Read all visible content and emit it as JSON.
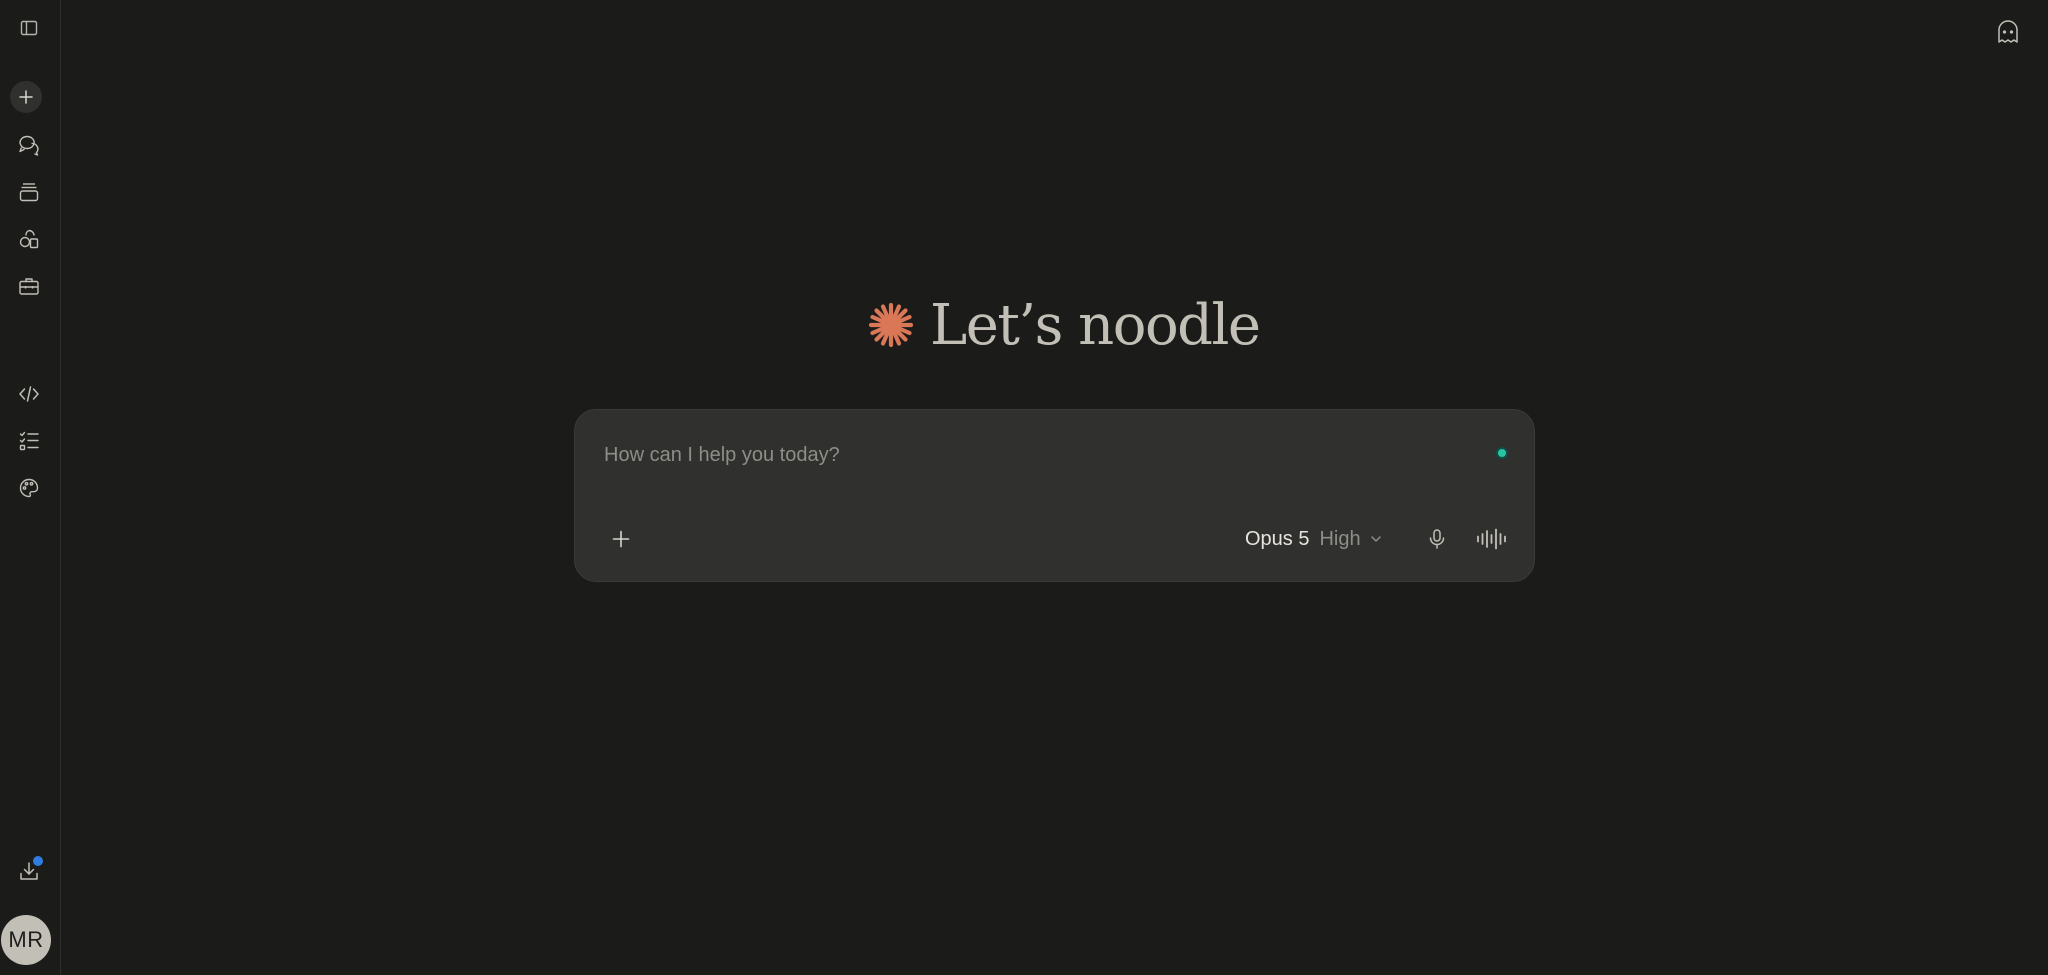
{
  "colors": {
    "background": "#1b1b1a",
    "composer": "#30302e",
    "accent_spark": "#d97757",
    "status_dot": "#2ac3a2",
    "notification_dot": "#2f7de1",
    "text_primary": "#c2c0b6",
    "text_muted": "#8e8d87"
  },
  "sidebar": {
    "toggle_icon": "sidebar-toggle-icon",
    "items": [
      {
        "name": "new-chat",
        "icon": "plus-icon"
      },
      {
        "name": "chats",
        "icon": "chat-bubbles-icon"
      },
      {
        "name": "projects",
        "icon": "stack-icon"
      },
      {
        "name": "artifacts",
        "icon": "shapes-icon"
      },
      {
        "name": "toolbox",
        "icon": "briefcase-icon"
      },
      {
        "name": "code",
        "icon": "code-icon"
      },
      {
        "name": "tasks",
        "icon": "checklist-icon"
      },
      {
        "name": "styles",
        "icon": "palette-icon"
      }
    ],
    "download_icon": "download-icon",
    "avatar_initials": "MR"
  },
  "header": {
    "incognito_icon": "ghost-icon"
  },
  "greeting": {
    "icon": "spark-icon",
    "text": "Let’s noodle"
  },
  "composer": {
    "placeholder": "How can I help you today?",
    "attach_icon": "plus-icon",
    "model_name": "Opus 5",
    "effort": "High",
    "mic_icon": "microphone-icon",
    "voice_icon": "voice-waveform-icon"
  }
}
